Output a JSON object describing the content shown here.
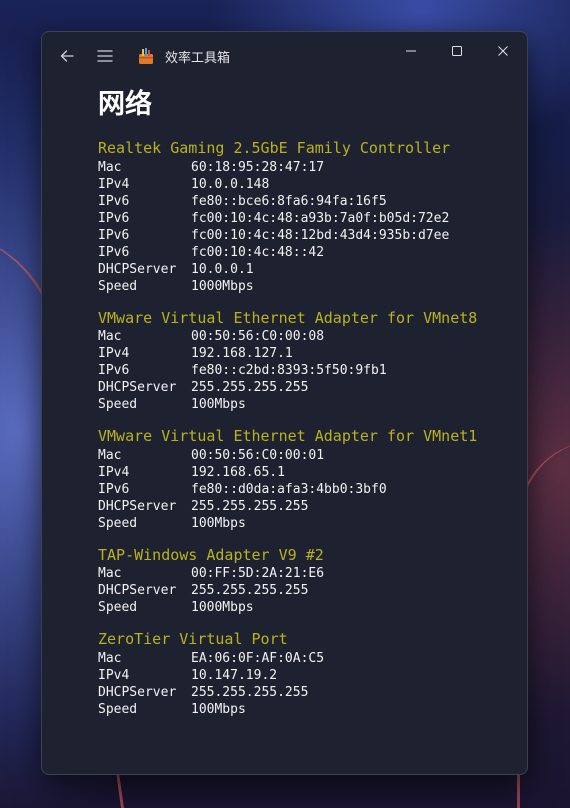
{
  "window": {
    "app_title": "效率工具箱",
    "page_title": "网络",
    "icons": {
      "back": "back-arrow-icon",
      "menu": "hamburger-menu-icon",
      "app": "toolbox-app-icon",
      "minimize": "minimize-icon",
      "maximize": "maximize-icon",
      "close": "close-icon"
    }
  },
  "colors": {
    "adapter_name": "#b9b31c",
    "text": "#f2f2f2",
    "window_bg": "#1e2230"
  },
  "adapters": [
    {
      "name": "Realtek Gaming 2.5GbE Family Controller",
      "rows": [
        {
          "key": "Mac",
          "value": "60:18:95:28:47:17"
        },
        {
          "key": "IPv4",
          "value": "10.0.0.148"
        },
        {
          "key": "IPv6",
          "value": "fe80::bce6:8fa6:94fa:16f5"
        },
        {
          "key": "IPv6",
          "value": "fc00:10:4c:48:a93b:7a0f:b05d:72e2"
        },
        {
          "key": "IPv6",
          "value": "fc00:10:4c:48:12bd:43d4:935b:d7ee"
        },
        {
          "key": "IPv6",
          "value": "fc00:10:4c:48::42"
        },
        {
          "key": "DHCPServer",
          "value": "10.0.0.1"
        },
        {
          "key": "Speed",
          "value": "1000Mbps"
        }
      ]
    },
    {
      "name": "VMware Virtual Ethernet Adapter for VMnet8",
      "rows": [
        {
          "key": "Mac",
          "value": "00:50:56:C0:00:08"
        },
        {
          "key": "IPv4",
          "value": "192.168.127.1"
        },
        {
          "key": "IPv6",
          "value": "fe80::c2bd:8393:5f50:9fb1"
        },
        {
          "key": "DHCPServer",
          "value": "255.255.255.255"
        },
        {
          "key": "Speed",
          "value": "100Mbps"
        }
      ]
    },
    {
      "name": "VMware Virtual Ethernet Adapter for VMnet1",
      "rows": [
        {
          "key": "Mac",
          "value": "00:50:56:C0:00:01"
        },
        {
          "key": "IPv4",
          "value": "192.168.65.1"
        },
        {
          "key": "IPv6",
          "value": "fe80::d0da:afa3:4bb0:3bf0"
        },
        {
          "key": "DHCPServer",
          "value": "255.255.255.255"
        },
        {
          "key": "Speed",
          "value": "100Mbps"
        }
      ]
    },
    {
      "name": "TAP-Windows Adapter V9 #2",
      "rows": [
        {
          "key": "Mac",
          "value": "00:FF:5D:2A:21:E6"
        },
        {
          "key": "DHCPServer",
          "value": "255.255.255.255"
        },
        {
          "key": "Speed",
          "value": "1000Mbps"
        }
      ]
    },
    {
      "name": "ZeroTier Virtual Port",
      "rows": [
        {
          "key": "Mac",
          "value": "EA:06:0F:AF:0A:C5"
        },
        {
          "key": "IPv4",
          "value": "10.147.19.2"
        },
        {
          "key": "DHCPServer",
          "value": "255.255.255.255"
        },
        {
          "key": "Speed",
          "value": "100Mbps"
        }
      ]
    }
  ]
}
